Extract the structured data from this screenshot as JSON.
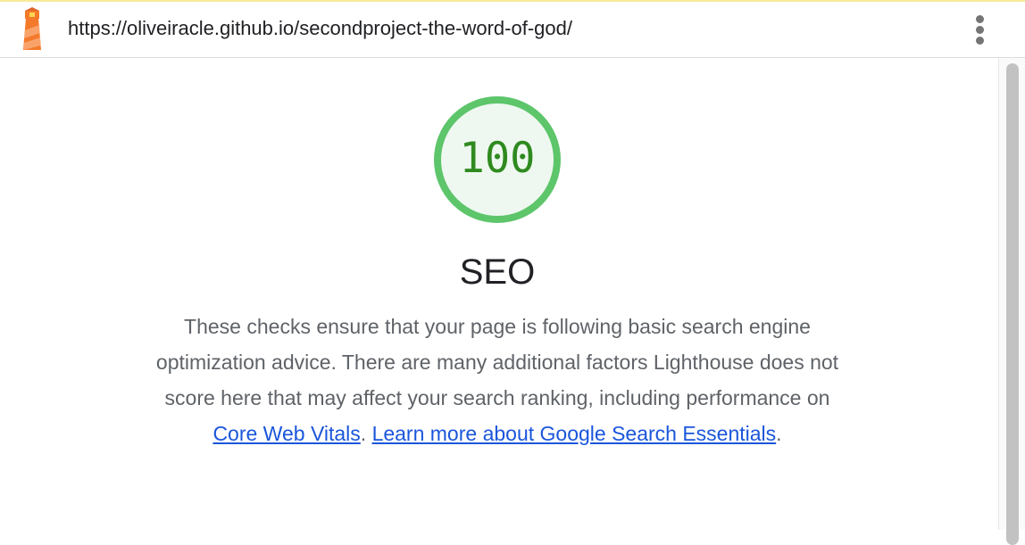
{
  "header": {
    "url": "https://oliveiracle.github.io/secondproject-the-word-of-god/",
    "logo_icon": "lighthouse-icon",
    "menu_icon": "more-vert-icon"
  },
  "category": {
    "score": "100",
    "score_value": 100,
    "title": "SEO",
    "description_part1": "These checks ensure that your page is following basic search engine optimization advice. There are many additional factors Lighthouse does not score here that may affect your search ranking, including performance on ",
    "link_core_web_vitals": "Core Web Vitals",
    "description_part2": ". ",
    "link_learn_more": "Learn more about Google Search Essentials",
    "description_end": "."
  },
  "colors": {
    "gauge_pass": "#5dc56a",
    "gauge_fill": "#eef8f0",
    "score_text": "#2f8a1f",
    "link": "#1a56db",
    "logo_orange": "#f4792b",
    "logo_yellow": "#ffd54f"
  }
}
